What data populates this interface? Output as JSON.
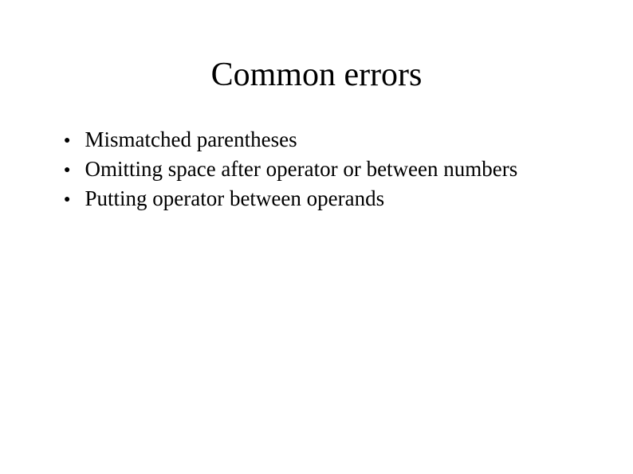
{
  "slide": {
    "title": "Common errors",
    "bullets": [
      "Mismatched parentheses",
      "Omitting space after operator or between numbers",
      "Putting operator between operands"
    ]
  }
}
